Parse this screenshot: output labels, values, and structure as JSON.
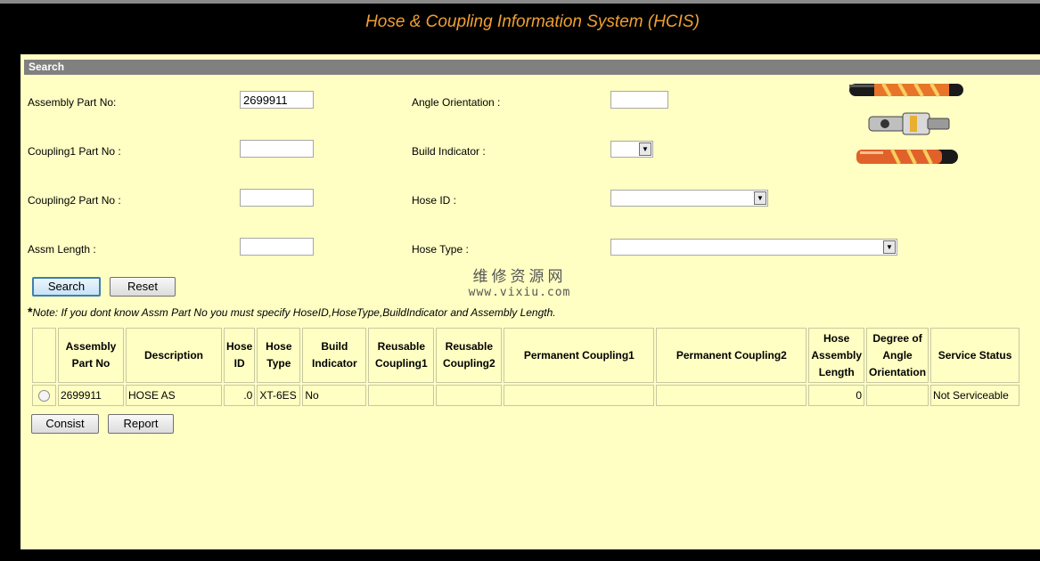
{
  "app_title": "Hose & Coupling Information System (HCIS)",
  "search": {
    "section_label": "Search",
    "assembly_part_no": {
      "label": "Assembly Part No:",
      "value": "2699911"
    },
    "coupling1_part_no": {
      "label": "Coupling1 Part No :",
      "value": ""
    },
    "coupling2_part_no": {
      "label": "Coupling2 Part No :",
      "value": ""
    },
    "assm_length": {
      "label": "Assm Length :",
      "value": ""
    },
    "angle_orientation": {
      "label": "Angle Orientation :",
      "value": ""
    },
    "build_indicator": {
      "label": "Build Indicator :",
      "value": ""
    },
    "hose_id": {
      "label": "Hose ID :",
      "value": ""
    },
    "hose_type": {
      "label": "Hose Type :",
      "value": ""
    },
    "search_button": "Search",
    "reset_button": "Reset",
    "note_star": "*",
    "note": "Note: If you dont know Assm Part No you must specify HoseID,HoseType,BuildIndicator and Assembly Length."
  },
  "watermark": {
    "line1": "维修资源网",
    "line2": "www.vixiu.com"
  },
  "results": {
    "columns": [
      "Assembly Part No",
      "Description",
      "Hose ID",
      "Hose Type",
      "Build Indicator",
      "Reusable Coupling1",
      "Reusable Coupling2",
      "Permanent Coupling1",
      "Permanent Coupling2",
      "Hose Assembly Length",
      "Degree of Angle Orientation",
      "Service Status"
    ],
    "rows": [
      {
        "assembly_part_no": "2699911",
        "description": "HOSE AS",
        "hose_id": ".0",
        "hose_type": "XT-6ES",
        "build_indicator": "No",
        "reusable_coupling1": "",
        "reusable_coupling2": "",
        "permanent_coupling1": "",
        "permanent_coupling2": "",
        "hose_assembly_length": "0",
        "degree_of_angle_orientation": "",
        "service_status": "Not Serviceable"
      }
    ]
  },
  "consist_button": "Consist",
  "report_button": "Report",
  "colors": {
    "title": "#f0a030",
    "panel": "#ffffc4",
    "section_bar": "#808080"
  }
}
